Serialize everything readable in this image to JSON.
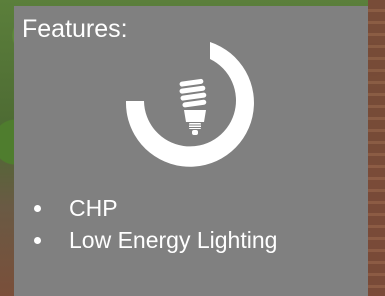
{
  "panel": {
    "title": "Features:",
    "background_color": "#808080",
    "text_color": "#ffffff",
    "graphic": {
      "icon": "lightbulb-icon",
      "ring": "circular-progress-ring"
    }
  },
  "features": [
    {
      "label": "CHP"
    },
    {
      "label": "Low Energy Lighting"
    }
  ]
}
